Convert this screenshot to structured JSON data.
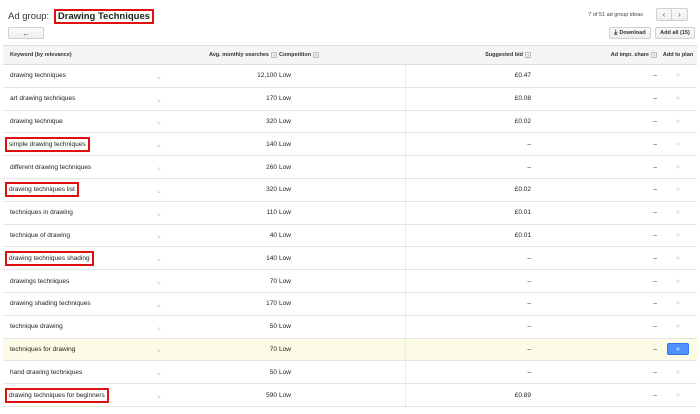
{
  "header": {
    "prefix": "Ad group:",
    "group_name": "Drawing Techniques",
    "back_icon": "←",
    "pager_text": "7 of 51 ad group ideas",
    "prev_icon": "‹",
    "next_icon": "›",
    "download_icon": "⤓",
    "download_label": "Download",
    "add_all_label": "Add all (15)"
  },
  "columns": {
    "keyword": "Keyword (by relevance)",
    "avg": "Avg. monthly searches",
    "competition": "Competition",
    "bid": "Suggested bid",
    "impr": "Ad impr. share",
    "add": "Add to plan",
    "help": "?"
  },
  "icons": {
    "trend": "⌞",
    "add": "»"
  },
  "rows": [
    {
      "keyword": "drawing techniques",
      "avg": "12,100",
      "competition": "Low",
      "bid": "£0.47",
      "impr": "–",
      "boxed": false,
      "highlight": false
    },
    {
      "keyword": "art drawing techniques",
      "avg": "170",
      "competition": "Low",
      "bid": "£0.08",
      "impr": "–",
      "boxed": false,
      "highlight": false
    },
    {
      "keyword": "drawing technique",
      "avg": "320",
      "competition": "Low",
      "bid": "£0.02",
      "impr": "–",
      "boxed": false,
      "highlight": false
    },
    {
      "keyword": "simple drawing techniques",
      "avg": "140",
      "competition": "Low",
      "bid": "–",
      "impr": "–",
      "boxed": true,
      "highlight": false
    },
    {
      "keyword": "different drawing techniques",
      "avg": "260",
      "competition": "Low",
      "bid": "–",
      "impr": "–",
      "boxed": false,
      "highlight": false
    },
    {
      "keyword": "drawing techniques list",
      "avg": "320",
      "competition": "Low",
      "bid": "£0.02",
      "impr": "–",
      "boxed": true,
      "highlight": false
    },
    {
      "keyword": "techniques in drawing",
      "avg": "110",
      "competition": "Low",
      "bid": "£0.01",
      "impr": "–",
      "boxed": false,
      "highlight": false
    },
    {
      "keyword": "technique of drawing",
      "avg": "40",
      "competition": "Low",
      "bid": "£0.01",
      "impr": "–",
      "boxed": false,
      "highlight": false
    },
    {
      "keyword": "drawing techniques shading",
      "avg": "140",
      "competition": "Low",
      "bid": "–",
      "impr": "–",
      "boxed": true,
      "highlight": false
    },
    {
      "keyword": "drawings techniques",
      "avg": "70",
      "competition": "Low",
      "bid": "–",
      "impr": "–",
      "boxed": false,
      "highlight": false
    },
    {
      "keyword": "drawing shading techniques",
      "avg": "170",
      "competition": "Low",
      "bid": "–",
      "impr": "–",
      "boxed": false,
      "highlight": false
    },
    {
      "keyword": "technique drawing",
      "avg": "50",
      "competition": "Low",
      "bid": "–",
      "impr": "–",
      "boxed": false,
      "highlight": false
    },
    {
      "keyword": "techniques for drawing",
      "avg": "70",
      "competition": "Low",
      "bid": "–",
      "impr": "–",
      "boxed": false,
      "highlight": true
    },
    {
      "keyword": "hand drawing techniques",
      "avg": "50",
      "competition": "Low",
      "bid": "–",
      "impr": "–",
      "boxed": false,
      "highlight": false
    },
    {
      "keyword": "drawing techniques for beginners",
      "avg": "590",
      "competition": "Low",
      "bid": "£0.89",
      "impr": "–",
      "boxed": true,
      "highlight": false
    }
  ]
}
